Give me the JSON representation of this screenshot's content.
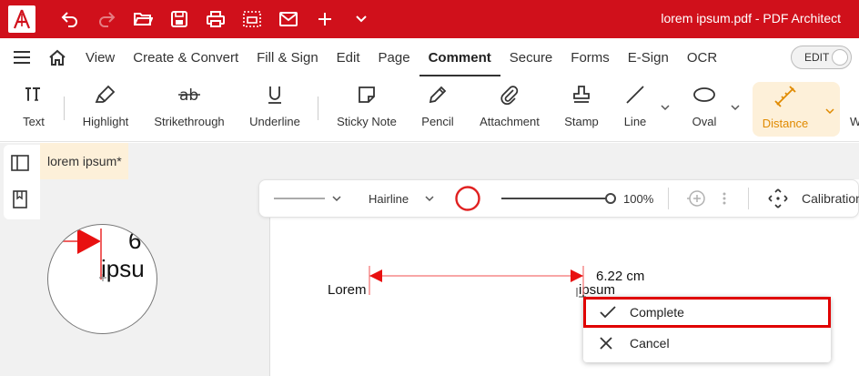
{
  "titlebar": {
    "title": "lorem ipsum.pdf  -  PDF Architect",
    "icons": [
      "undo-icon",
      "redo-icon",
      "open-folder-icon",
      "save-icon",
      "print-icon",
      "scan-print-icon",
      "mail-icon",
      "plus-icon",
      "chevron-down-icon"
    ],
    "color": "#d0101b"
  },
  "menu": {
    "items": [
      "View",
      "Create & Convert",
      "Fill & Sign",
      "Edit",
      "Page",
      "Comment",
      "Secure",
      "Forms",
      "E-Sign",
      "OCR"
    ],
    "active": "Comment",
    "edit_toggle": "EDIT"
  },
  "ribbon": {
    "tools": [
      "Text",
      "Highlight",
      "Strikethrough",
      "Underline",
      "Sticky Note",
      "Pencil",
      "Attachment",
      "Stamp",
      "Line",
      "Oval",
      "Distance",
      "W"
    ],
    "active": "Distance",
    "active_color": "#e08a00",
    "active_bg": "#fdf0d9"
  },
  "doc_tab": {
    "label": "lorem ipsum",
    "modified_mark": "*"
  },
  "props": {
    "line_weight": "Hairline",
    "opacity": "100%",
    "opacity_value": 1.0,
    "calibration": "Calibration",
    "stroke_color": "#e02020"
  },
  "magnifier": {
    "text_top": "6",
    "text_bottom": "ipsu"
  },
  "document": {
    "word_left": "Lorem",
    "word_right": "ipsum",
    "measurement": "6.22 cm"
  },
  "context_menu": {
    "complete": "Complete",
    "cancel": "Cancel"
  }
}
